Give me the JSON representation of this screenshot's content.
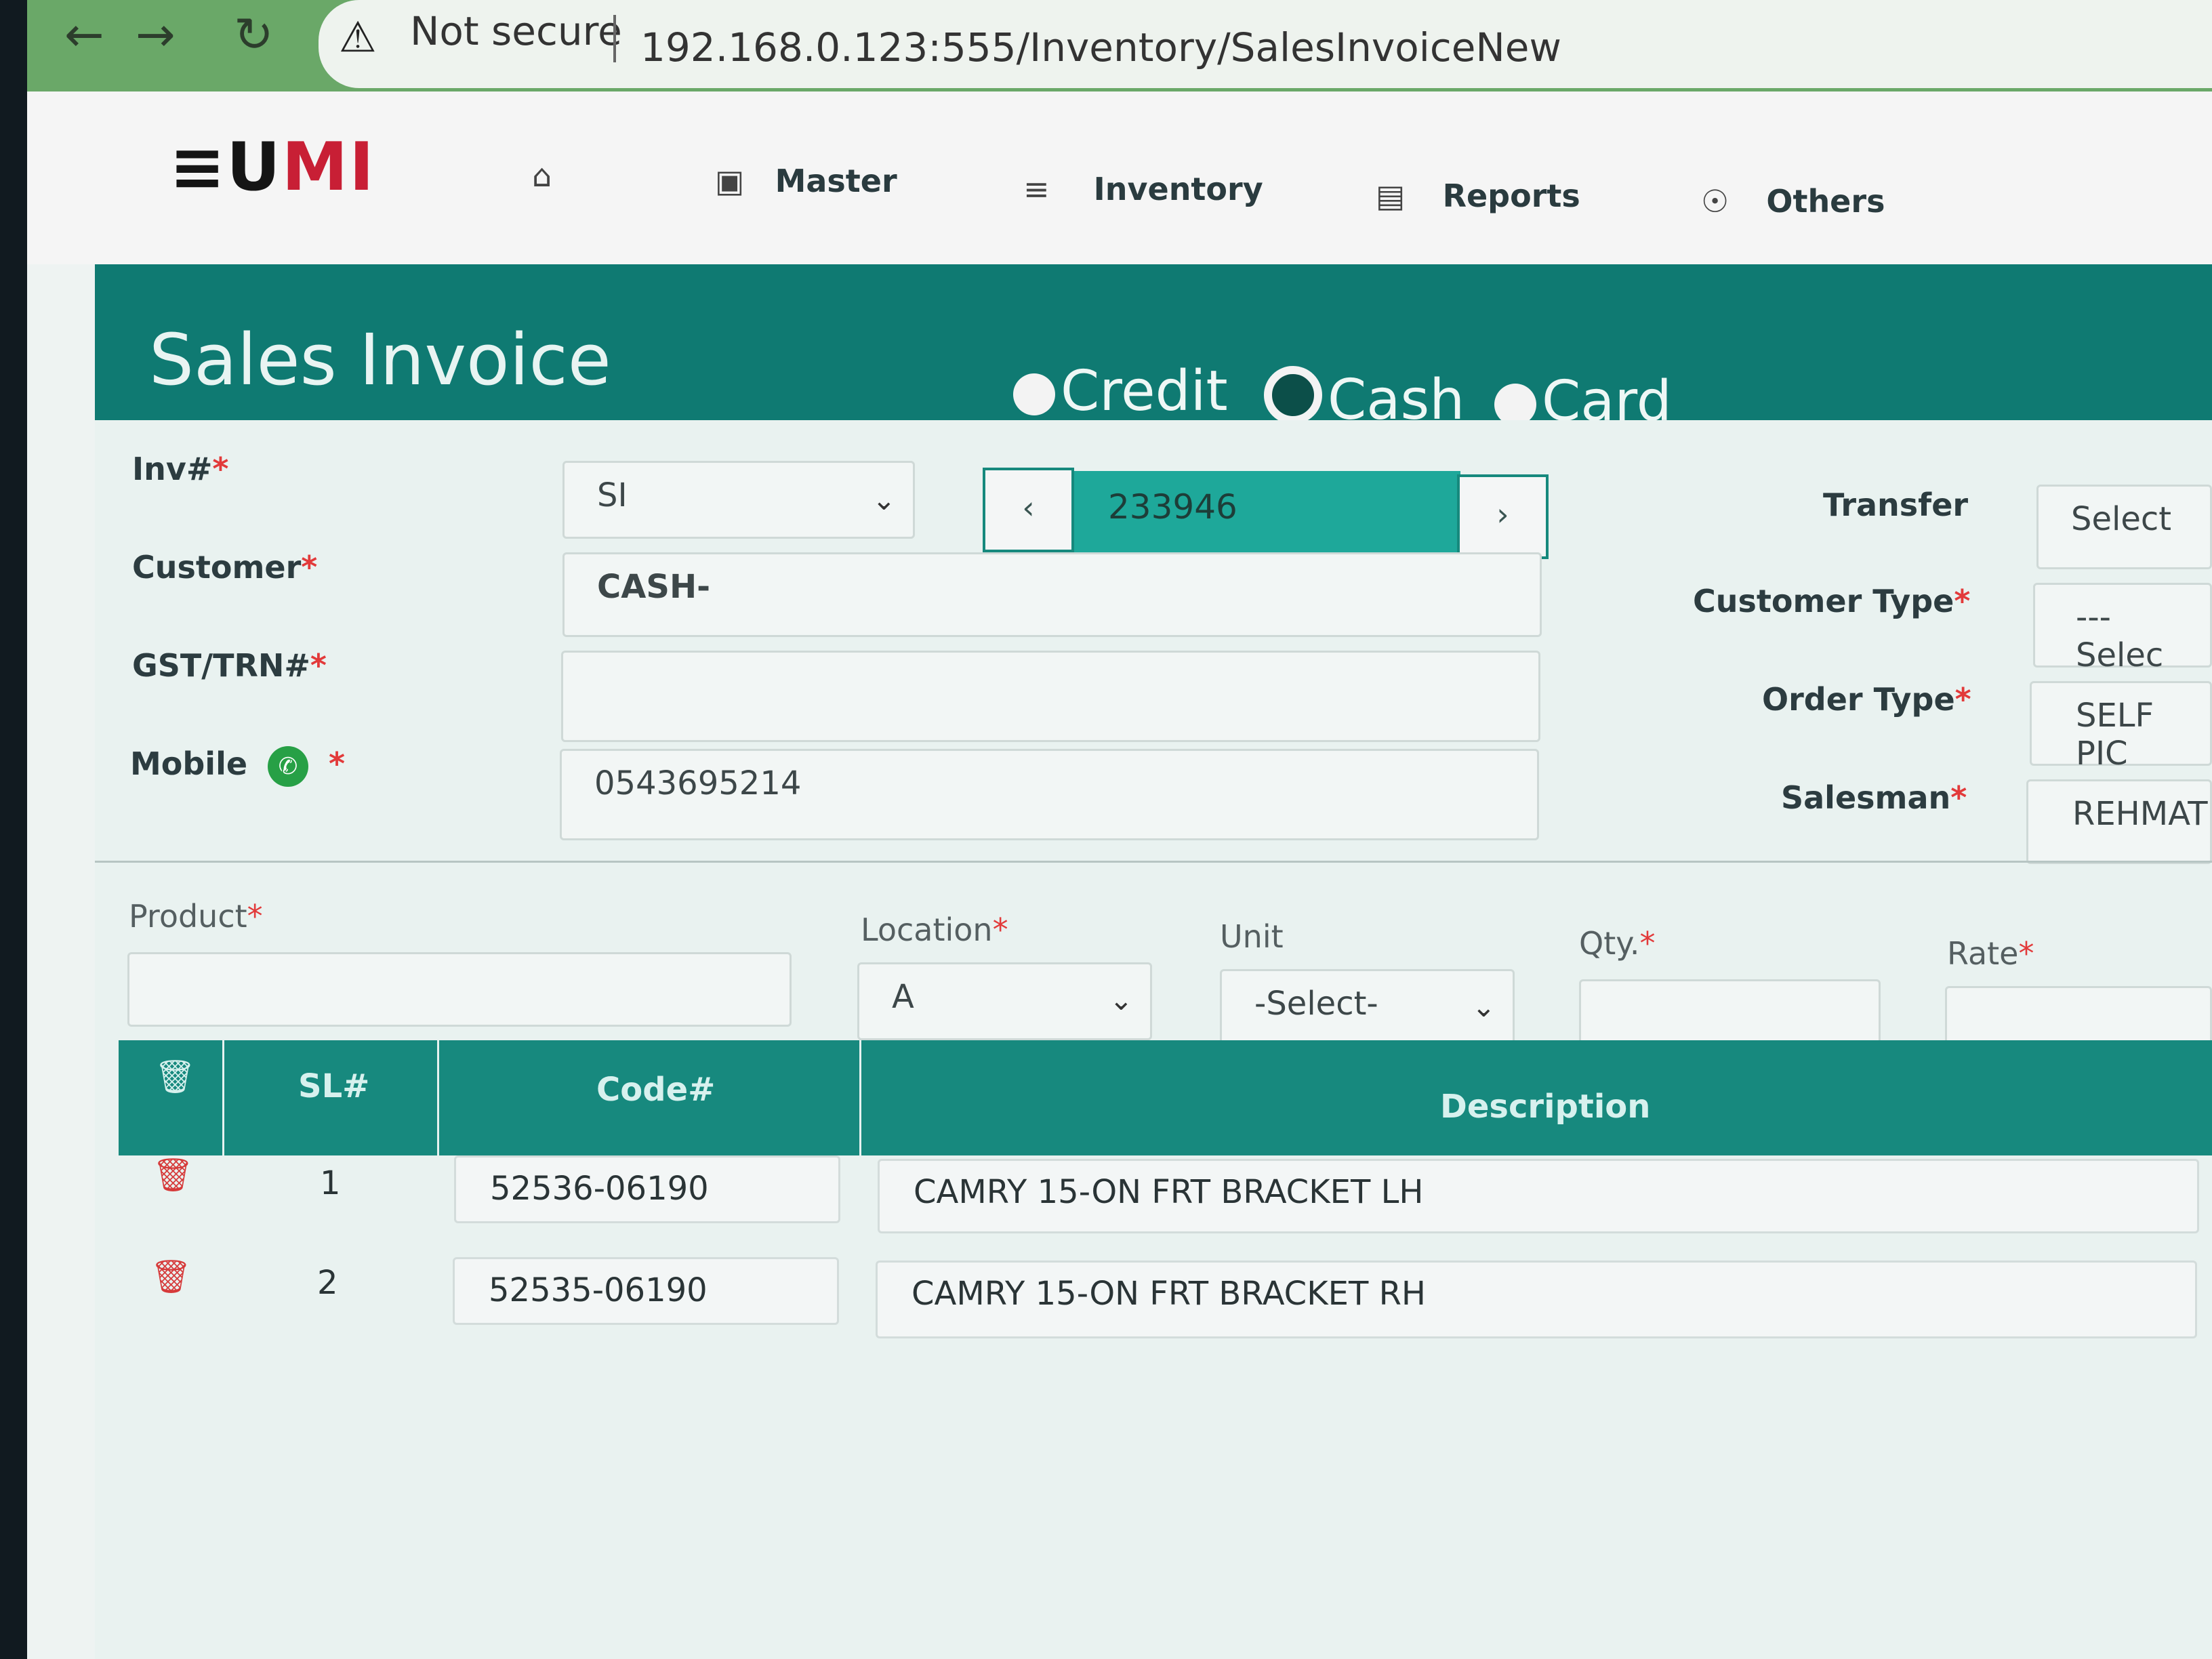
{
  "browser": {
    "security_label": "Not secure",
    "url": "192.168.0.123:555/Inventory/SalesInvoiceNew"
  },
  "app": {
    "logo_text_dark": "≡U",
    "logo_text_red": "MI",
    "nav": [
      {
        "label": "",
        "icon": "home-icon"
      },
      {
        "label": "Master",
        "icon": "cube-icon"
      },
      {
        "label": "Inventory",
        "icon": "layers-icon"
      },
      {
        "label": "Reports",
        "icon": "bar-chart-icon"
      },
      {
        "label": "Others",
        "icon": "globe-icon"
      }
    ]
  },
  "page": {
    "title": "Sales Invoice",
    "payment_modes": [
      {
        "label": "Credit",
        "selected": false
      },
      {
        "label": "Cash",
        "selected": true
      },
      {
        "label": "Card",
        "selected": false
      }
    ]
  },
  "form": {
    "inv_label": "Inv#",
    "inv_prefix": "SI",
    "inv_number": "233946",
    "customer_label": "Customer",
    "customer_value": "CASH-",
    "gst_label": "GST/TRN#",
    "gst_value": "",
    "mobile_label": "Mobile",
    "mobile_value": "0543695214",
    "transfer_label": "Transfer",
    "transfer_value": "Select",
    "customer_type_label": "Customer Type",
    "customer_type_value": "---Selec",
    "order_type_label": "Order Type",
    "order_type_value": "SELF PIC",
    "salesman_label": "Salesman",
    "salesman_value": "REHMAT"
  },
  "entry": {
    "product_label": "Product",
    "location_label": "Location",
    "location_value": "A",
    "unit_label": "Unit",
    "unit_value": "-Select-",
    "qty_label": "Qty.",
    "rate_label": "Rate"
  },
  "table": {
    "headers": {
      "sl": "SL#",
      "code": "Code#",
      "description": "Description"
    },
    "rows": [
      {
        "sl": "1",
        "code": "52536-06190",
        "description": "CAMRY 15-ON FRT BRACKET LH"
      },
      {
        "sl": "2",
        "code": "52535-06190",
        "description": "CAMRY 15-ON FRT BRACKET RH"
      }
    ]
  },
  "colors": {
    "teal": "#0f7a72",
    "teal_light": "#1ea89a",
    "brand_red": "#c81f35",
    "required_red": "#e23a3a",
    "browser_green": "#6aa868"
  }
}
